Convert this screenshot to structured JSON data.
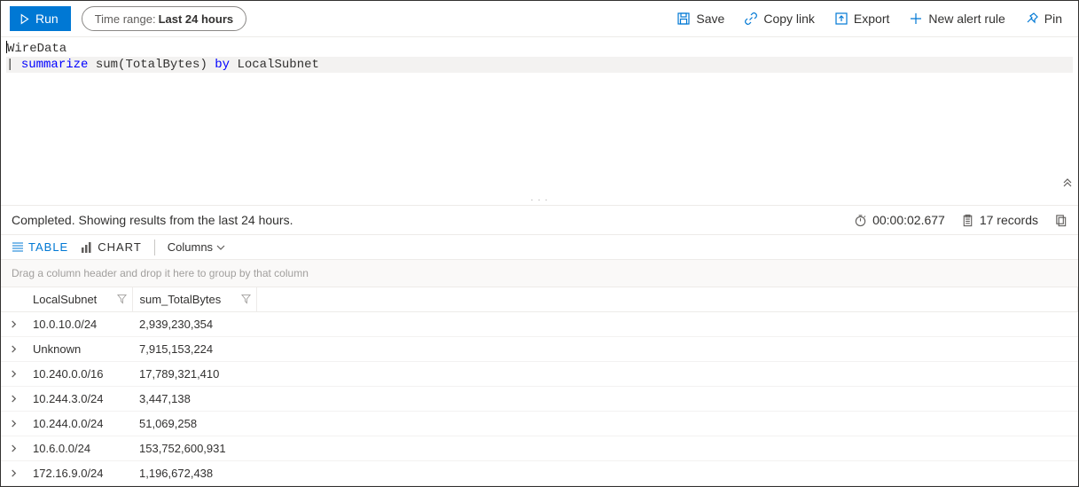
{
  "toolbar": {
    "run": "Run",
    "timerange_label": "Time range:",
    "timerange_value": "Last 24 hours",
    "save": "Save",
    "copylink": "Copy link",
    "export": "Export",
    "newalert": "New alert rule",
    "pin": "Pin"
  },
  "editor": {
    "line1": "WireData",
    "line2_pipe": "| ",
    "line2_kw1": "summarize",
    "line2_fn": " sum(TotalBytes) ",
    "line2_kw2": "by",
    "line2_id": " LocalSubnet"
  },
  "status": {
    "message": "Completed. Showing results from the last 24 hours.",
    "elapsed": "00:00:02.677",
    "records": "17 records"
  },
  "viewbar": {
    "table": "TABLE",
    "chart": "CHART",
    "columns": "Columns"
  },
  "group_hint": "Drag a column header and drop it here to group by that column",
  "columns": [
    "LocalSubnet",
    "sum_TotalBytes"
  ],
  "rows": [
    {
      "c0": "10.0.10.0/24",
      "c1": "2,939,230,354"
    },
    {
      "c0": "Unknown",
      "c1": "7,915,153,224"
    },
    {
      "c0": "10.240.0.0/16",
      "c1": "17,789,321,410"
    },
    {
      "c0": "10.244.3.0/24",
      "c1": "3,447,138"
    },
    {
      "c0": "10.244.0.0/24",
      "c1": "51,069,258"
    },
    {
      "c0": "10.6.0.0/24",
      "c1": "153,752,600,931"
    },
    {
      "c0": "172.16.9.0/24",
      "c1": "1,196,672,438"
    }
  ]
}
